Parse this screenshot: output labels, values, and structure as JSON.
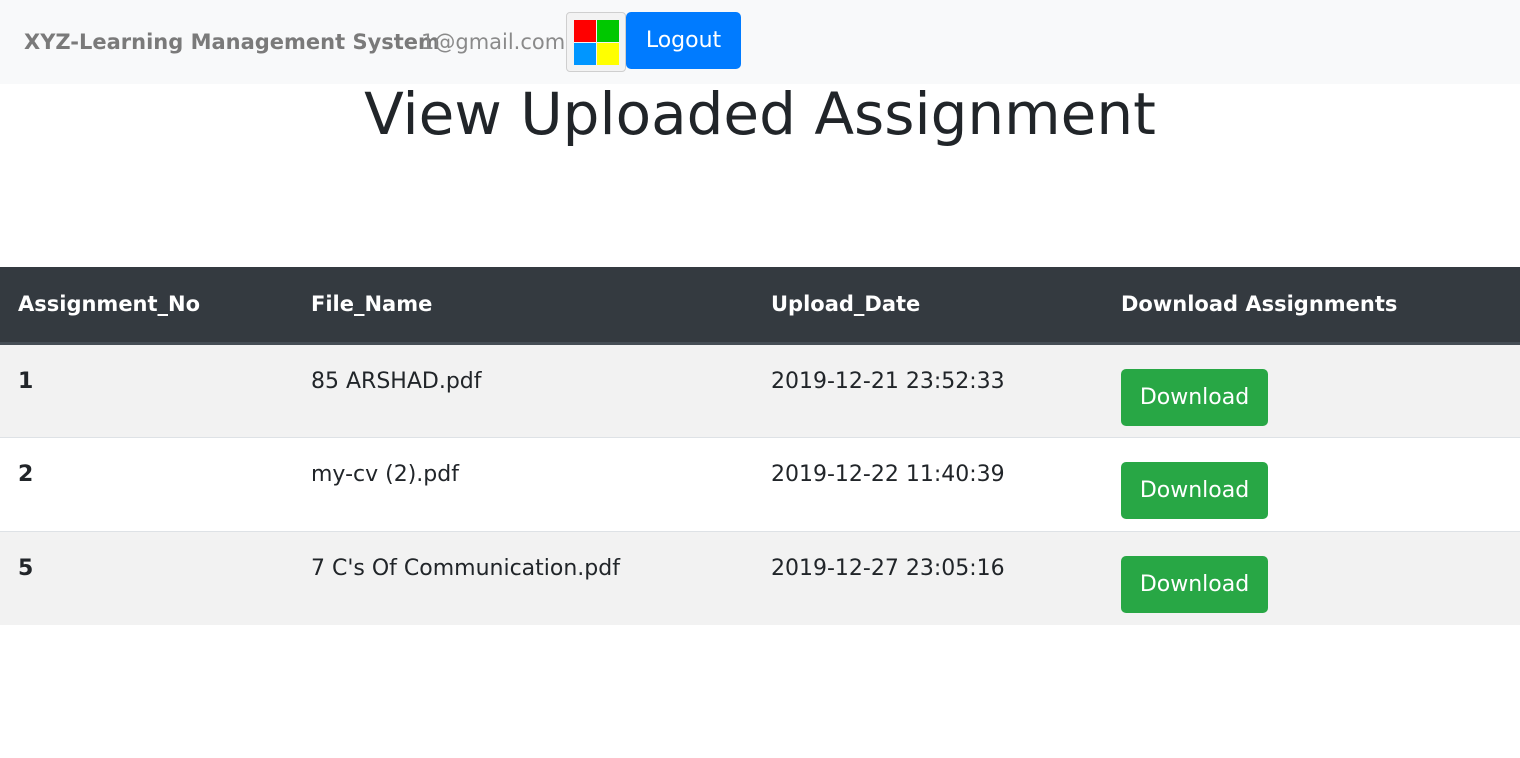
{
  "navbar": {
    "brand": "XYZ-Learning Management System",
    "user_email": "1@gmail.com",
    "logo_icon": "windows-logo-icon",
    "logout_label": "Logout"
  },
  "main": {
    "title": "View Uploaded Assignment"
  },
  "table": {
    "headers": [
      "Assignment_No",
      "File_Name",
      "Upload_Date",
      "Download Assignments"
    ],
    "rows": [
      {
        "assignment_no": "1",
        "file_name": "85 ARSHAD.pdf",
        "upload_date": "2019-12-21 23:52:33",
        "action_label": "Download"
      },
      {
        "assignment_no": "2",
        "file_name": "my-cv (2).pdf",
        "upload_date": "2019-12-22 11:40:39",
        "action_label": "Download"
      },
      {
        "assignment_no": "5",
        "file_name": "7 C's Of Communication.pdf",
        "upload_date": "2019-12-27 23:05:16",
        "action_label": "Download"
      }
    ]
  },
  "colors": {
    "navbar_bg": "#f8f9fa",
    "logout_button": "#007bff",
    "table_header_bg": "#343a40",
    "download_button": "#28a745",
    "logo_red": "#ff0000",
    "logo_green": "#00c800",
    "logo_blue": "#0096ff",
    "logo_yellow": "#ffff00"
  }
}
